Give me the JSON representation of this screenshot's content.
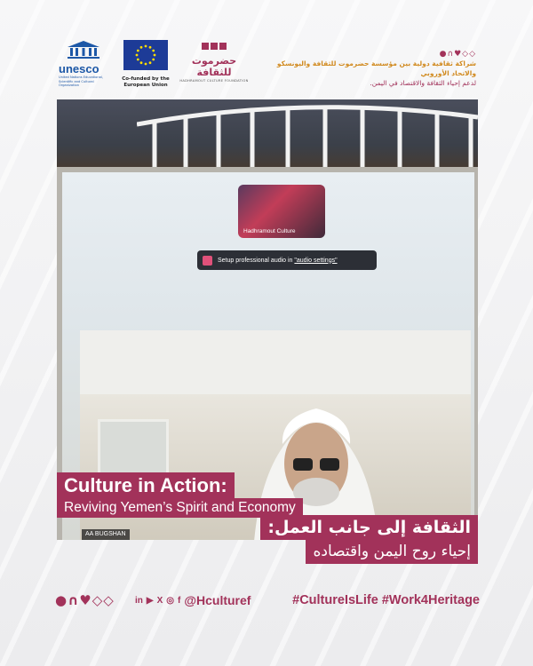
{
  "header": {
    "unesco": {
      "wordmark": "unesco",
      "subtitle": "United Nations Educational, Scientific and Cultural Organization"
    },
    "eu": {
      "cofunded": "Co-funded by the European Union"
    },
    "hcf": {
      "arabic": "حضرموت للثقافة",
      "english": "HADHRAMOUT CULTURE FOUNDATION"
    },
    "partnership_line1": "شراكة ثقافية دولية بين مؤسسة حضرموت للثقافة واليونسكو والاتحاد الأوروبي",
    "partnership_line2": "لدعم إحياء الثقافة والاقتصاد في اليمن."
  },
  "photo": {
    "thumbnail_caption": "Hadhramout Culture",
    "audio_prompt_text": "Setup professional audio in ",
    "audio_prompt_link": "\"audio settings\"",
    "participant_name": "AA BUGSHAN"
  },
  "titles": {
    "en_line1": "Culture in Action:",
    "en_line2": "Reviving Yemen’s Spirit and Economy",
    "ar_line1": "الثقافة إلى جانب العمل:",
    "ar_line2": "إحياء روح اليمن واقتصاده"
  },
  "footer": {
    "handle": "@Hculturef",
    "hashtags": "#CultureIsLife #Work4Heritage",
    "social_icons": [
      "linkedin-icon",
      "youtube-icon",
      "x-icon",
      "instagram-icon",
      "facebook-icon"
    ]
  },
  "colors": {
    "brand": "#a2325a",
    "accent_orange": "#d18a1f",
    "unesco_blue": "#1d58a7",
    "eu_blue": "#1d3b97"
  }
}
